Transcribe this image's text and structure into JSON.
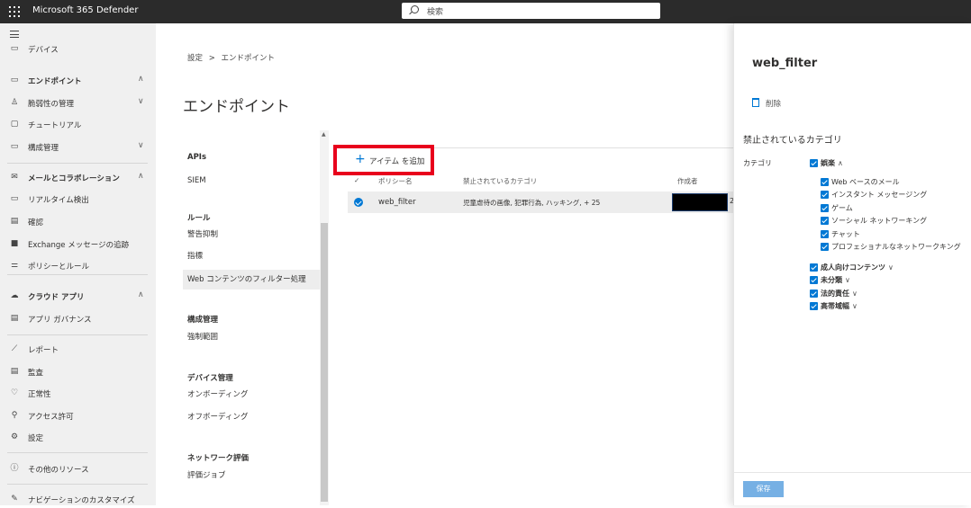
{
  "app": {
    "title": "Microsoft 365 Defender"
  },
  "search": {
    "placeholder": "検索"
  },
  "leftnav": {
    "items": [
      {
        "label": "デバイス",
        "icon": "device-icon",
        "bold": false,
        "chevron": ""
      },
      {
        "label": "エンドポイント",
        "icon": "endpoint-icon",
        "bold": true,
        "chevron": "∧"
      },
      {
        "label": "脆弱性の管理",
        "icon": "vulnerability-icon",
        "bold": false,
        "chevron": "∨"
      },
      {
        "label": "チュートリアル",
        "icon": "tutorial-icon",
        "bold": false,
        "chevron": ""
      },
      {
        "label": "構成管理",
        "icon": "configuration-icon",
        "bold": false,
        "chevron": "∨"
      },
      {
        "label": "メールとコラボレーション",
        "icon": "mail-icon",
        "bold": true,
        "chevron": "∧"
      },
      {
        "label": "リアルタイム検出",
        "icon": "realtime-detection-icon",
        "bold": false,
        "chevron": ""
      },
      {
        "label": "確認",
        "icon": "review-icon",
        "bold": false,
        "chevron": ""
      },
      {
        "label": "Exchange メッセージの追跡",
        "icon": "exchange-icon",
        "bold": false,
        "chevron": ""
      },
      {
        "label": "ポリシーとルール",
        "icon": "policy-icon",
        "bold": false,
        "chevron": ""
      },
      {
        "label": "クラウド アプリ",
        "icon": "cloud-icon",
        "bold": true,
        "chevron": "∧"
      },
      {
        "label": "アプリ ガバナンス",
        "icon": "governance-icon",
        "bold": false,
        "chevron": ""
      },
      {
        "label": "レポート",
        "icon": "report-icon",
        "bold": false,
        "chevron": ""
      },
      {
        "label": "監査",
        "icon": "audit-icon",
        "bold": false,
        "chevron": ""
      },
      {
        "label": "正常性",
        "icon": "health-icon",
        "bold": false,
        "chevron": ""
      },
      {
        "label": "アクセス許可",
        "icon": "permissions-icon",
        "bold": false,
        "chevron": ""
      },
      {
        "label": "設定",
        "icon": "settings-icon",
        "bold": false,
        "chevron": ""
      },
      {
        "label": "その他のリソース",
        "icon": "info-icon",
        "bold": false,
        "chevron": ""
      },
      {
        "label": "ナビゲーションのカスタマイズ",
        "icon": "pencil-icon",
        "bold": false,
        "chevron": ""
      }
    ]
  },
  "breadcrumb": {
    "root": "設定",
    "separator": ">",
    "current": "エンドポイント"
  },
  "page": {
    "title": "エンドポイント"
  },
  "subnav": {
    "groups": [
      {
        "heading": "APIs",
        "items": [
          "SIEM"
        ]
      },
      {
        "heading": "ルール",
        "items": [
          "警告抑制",
          "指標",
          "Web コンテンツのフィルター処理"
        ]
      },
      {
        "heading": "構成管理",
        "items": [
          "強制範囲"
        ]
      },
      {
        "heading": "デバイス管理",
        "items": [
          "オンボーディング",
          "オフボーディング"
        ]
      },
      {
        "heading": "ネットワーク評価",
        "items": [
          "評価ジョブ"
        ]
      }
    ],
    "active": "Web コンテンツのフィルター処理"
  },
  "toolbar": {
    "add_label": "アイテム を追加"
  },
  "table": {
    "columns": [
      "✓",
      "ポリシー名",
      "禁止されているカテゴリ",
      "作成者"
    ],
    "rows": [
      {
        "name": "web_filter",
        "categories": "児童虐待の画像, 犯罪行為, ハッキング, + 25",
        "extra": "2"
      }
    ]
  },
  "panel": {
    "title": "web_filter",
    "delete_label": "削除",
    "section_title": "禁止されているカテゴリ",
    "category_label": "カテゴリ",
    "groups": [
      {
        "label": "娯楽",
        "chevron": "∧",
        "children": [
          "Web ベースのメール",
          "インスタント メッセージング",
          "ゲーム",
          "ソーシャル ネットワーキング",
          "チャット",
          "プロフェショナルなネットワークキング"
        ]
      },
      {
        "label": "成人向けコンテンツ",
        "chevron": "∨",
        "children": []
      },
      {
        "label": "未分類",
        "chevron": "∨",
        "children": []
      },
      {
        "label": "法的責任",
        "chevron": "∨",
        "children": []
      },
      {
        "label": "高帯域幅",
        "chevron": "∨",
        "children": []
      }
    ],
    "save_label": "保存"
  },
  "colors": {
    "topbar": "#2b2b2b",
    "accent": "#0078d4",
    "highlight": "#e8001c",
    "save": "#76b0e4"
  }
}
